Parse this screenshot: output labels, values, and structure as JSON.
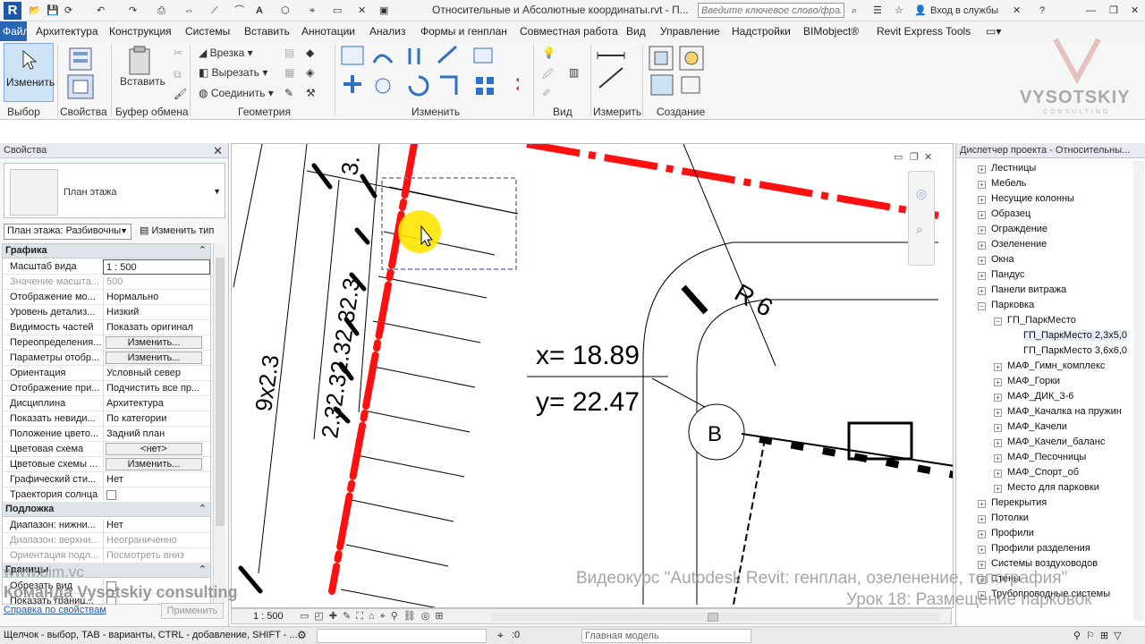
{
  "app": {
    "title": "Относительные и Абсолютные координаты.rvt - П...",
    "search_placeholder": "Введите ключевое слово/фразу",
    "login_label": "Вход в службы",
    "logo_letter": "R"
  },
  "menu": {
    "items": [
      "Файл",
      "Архитектура",
      "Конструкция",
      "Системы",
      "Вставить",
      "Аннотации",
      "Анализ",
      "Формы и генплан",
      "Совместная работа",
      "Вид",
      "Управление",
      "Надстройки",
      "BIMobject®",
      "Revit Express Tools"
    ]
  },
  "ribbon": {
    "modify_label": "Изменить",
    "paste_label": "Вставить",
    "cut_label": "Врезка",
    "cutout_label": "Вырезать",
    "join_label": "Соединить",
    "panels": [
      "Выбор",
      "Свойства",
      "Буфер обмена",
      "Геометрия",
      "Изменить",
      "Вид",
      "Измерить",
      "Создание"
    ]
  },
  "watermark": {
    "brand": "VYSOTSKIY",
    "sub": "CONSULTING"
  },
  "properties": {
    "header": "Свойства",
    "type_name": "План этажа",
    "instance_filter": "План этажа: Разбивочны",
    "edit_type": "Изменить тип",
    "sections": [
      {
        "name": "Графика",
        "rows": [
          {
            "k": "Масштаб вида",
            "v": "1 : 500",
            "kind": "box"
          },
          {
            "k": "Значение масшта...",
            "v": "500",
            "kind": "dim"
          },
          {
            "k": "Отображение мо...",
            "v": "Нормально"
          },
          {
            "k": "Уровень детализ...",
            "v": "Низкий"
          },
          {
            "k": "Видимость частей",
            "v": "Показать оригинал"
          },
          {
            "k": "Переопределения...",
            "v": "Изменить...",
            "kind": "btn"
          },
          {
            "k": "Параметры отобр...",
            "v": "Изменить...",
            "kind": "btn"
          },
          {
            "k": "Ориентация",
            "v": "Условный север"
          },
          {
            "k": "Отображение при...",
            "v": "Подчистить все пр..."
          },
          {
            "k": "Дисциплина",
            "v": "Архитектура"
          },
          {
            "k": "Показать невиди...",
            "v": "По категории"
          },
          {
            "k": "Положение цвето...",
            "v": "Задний план"
          },
          {
            "k": "Цветовая схема",
            "v": "<нет>",
            "kind": "btn"
          },
          {
            "k": "Цветовые схемы ...",
            "v": "Изменить...",
            "kind": "btn"
          },
          {
            "k": "Графический сти...",
            "v": "Нет"
          },
          {
            "k": "Траектория солнца",
            "v": "",
            "kind": "cb"
          }
        ]
      },
      {
        "name": "Подложка",
        "rows": [
          {
            "k": "Диапазон: нижни...",
            "v": "Нет"
          },
          {
            "k": "Диапазон: верхни...",
            "v": "Неограниченно",
            "kind": "dim"
          },
          {
            "k": "Ориентация подл...",
            "v": "Посмотреть вниз",
            "kind": "dim"
          }
        ]
      },
      {
        "name": "Границы",
        "rows": [
          {
            "k": "Обрезать вид",
            "v": "",
            "kind": "cb"
          },
          {
            "k": "Показать границ...",
            "v": "",
            "kind": "cb"
          }
        ]
      }
    ],
    "help_link": "Справка по свойствам",
    "apply": "Применить"
  },
  "view": {
    "scale": "1 : 500",
    "coord_x": "x=  18.89",
    "coord_y": "y=  22.47",
    "radius": "R 6",
    "marker": "B",
    "dim_total": "9x2.3",
    "dim_chain": "2.32.32.32.32.3",
    "dim_top": "3."
  },
  "browser": {
    "header": "Диспетчер проекта - Относительны...",
    "items": [
      {
        "label": "Лестницы",
        "level": 1,
        "exp": "+"
      },
      {
        "label": "Мебель",
        "level": 1,
        "exp": "+"
      },
      {
        "label": "Несущие колонны",
        "level": 1,
        "exp": "+"
      },
      {
        "label": "Образец",
        "level": 1,
        "exp": "+"
      },
      {
        "label": "Ограждение",
        "level": 1,
        "exp": "+"
      },
      {
        "label": "Озеленение",
        "level": 1,
        "exp": "+"
      },
      {
        "label": "Окна",
        "level": 1,
        "exp": "+"
      },
      {
        "label": "Пандус",
        "level": 1,
        "exp": "+"
      },
      {
        "label": "Панели витража",
        "level": 1,
        "exp": "+"
      },
      {
        "label": "Парковка",
        "level": 1,
        "exp": "−"
      },
      {
        "label": "ГП_ПаркМесто",
        "level": 2,
        "exp": "−"
      },
      {
        "label": "ГП_ПаркМесто 2,3x5,0",
        "level": 3,
        "exp": "",
        "sel": true
      },
      {
        "label": "ГП_ПаркМесто 3,6x6,0",
        "level": 3,
        "exp": ""
      },
      {
        "label": "МАФ_Гимн_комплекс",
        "level": 2,
        "exp": "+"
      },
      {
        "label": "МАФ_Горки",
        "level": 2,
        "exp": "+"
      },
      {
        "label": "МАФ_ДИК_3-6",
        "level": 2,
        "exp": "+"
      },
      {
        "label": "МАФ_Качалка на пружин",
        "level": 2,
        "exp": "+"
      },
      {
        "label": "МАФ_Качели",
        "level": 2,
        "exp": "+"
      },
      {
        "label": "МАФ_Качели_баланс",
        "level": 2,
        "exp": "+"
      },
      {
        "label": "МАФ_Песочницы",
        "level": 2,
        "exp": "+"
      },
      {
        "label": "МАФ_Спорт_об",
        "level": 2,
        "exp": "+"
      },
      {
        "label": "Место для парковки",
        "level": 2,
        "exp": "+"
      },
      {
        "label": "Перекрытия",
        "level": 1,
        "exp": "+"
      },
      {
        "label": "Потолки",
        "level": 1,
        "exp": "+"
      },
      {
        "label": "Профили",
        "level": 1,
        "exp": "+"
      },
      {
        "label": "Профили разделения",
        "level": 1,
        "exp": "+"
      },
      {
        "label": "Системы воздуховодов",
        "level": 1,
        "exp": "+"
      },
      {
        "label": "Стены",
        "level": 1,
        "exp": "+"
      },
      {
        "label": "Трубопроводные системы",
        "level": 1,
        "exp": "+"
      }
    ]
  },
  "status": {
    "hint": "Щелчок - выбор, TAB - варианты, CTRL - добавление, SHIFT - ...",
    "count": ":0",
    "model": "Главная модель"
  },
  "overlay": {
    "course": "Видеокурс \"Autodesk Revit: генплан, озеленение, топография\"",
    "lesson": "Урок 18: Размещение парковок",
    "site": "www.bim.vc",
    "team": "Команда Vysotskiy consulting"
  },
  "colors": {
    "accent": "#2a66b6",
    "red": "#ff0000",
    "highlight": "#ffe600"
  }
}
